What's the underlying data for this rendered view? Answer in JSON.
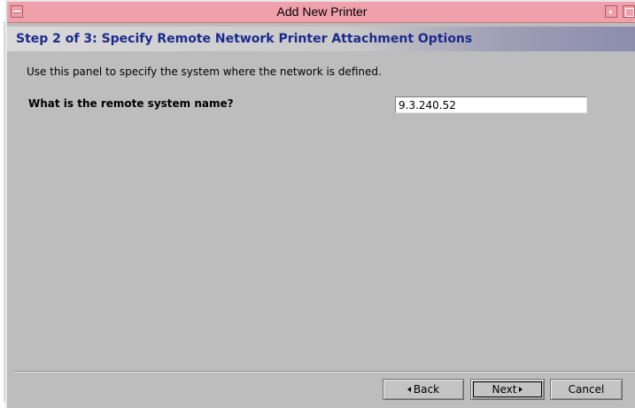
{
  "window": {
    "title": "Add New Printer"
  },
  "step": {
    "title": "Step 2 of 3: Specify Remote Network Printer Attachment Options"
  },
  "panel": {
    "description": "Use this panel to specify the system where the network is defined.",
    "question_label": "What is the remote system name?",
    "remote_system_value": "9.3.240.52"
  },
  "buttons": {
    "back_label": "Back",
    "next_label": "Next",
    "cancel_label": "Cancel"
  },
  "colors": {
    "titlebar": "#f0a0aa",
    "step_title": "#1c2a8c",
    "panel_bg": "#bdbdbd"
  },
  "icons": {
    "window_menu": "window-menu-icon",
    "minimize": "minimize-icon",
    "maximize": "maximize-icon",
    "back_arrow": "arrow-left-icon",
    "next_arrow": "arrow-right-icon"
  }
}
